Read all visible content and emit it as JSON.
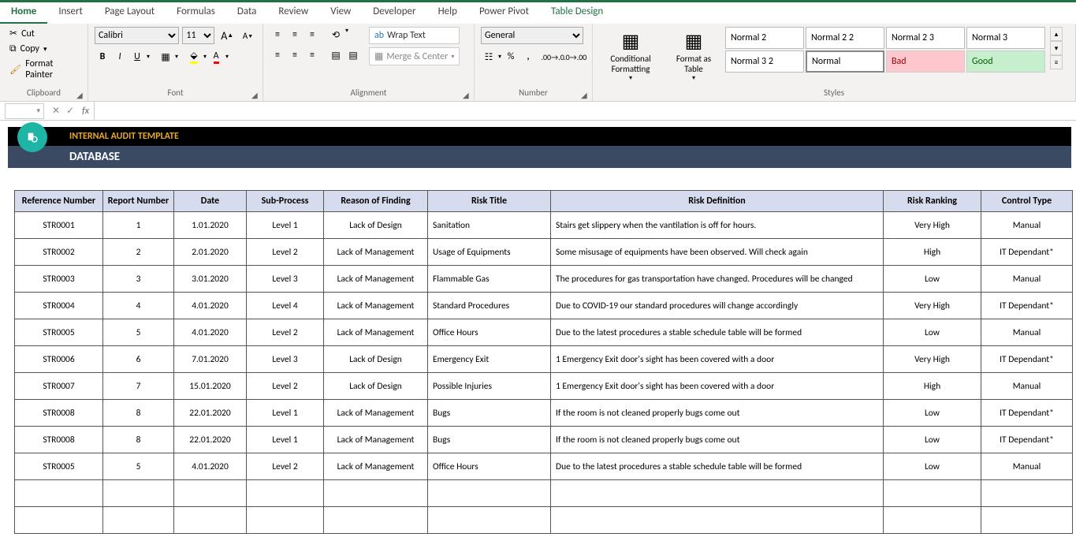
{
  "tabs": [
    "Home",
    "Insert",
    "Page Layout",
    "Formulas",
    "Data",
    "Review",
    "View",
    "Developer",
    "Help",
    "Power Pivot",
    "Table Design"
  ],
  "clipboard": {
    "cut": "Cut",
    "copy": "Copy",
    "painter": "Format Painter",
    "label": "Clipboard"
  },
  "font": {
    "name": "Calibri",
    "size": "11",
    "label": "Font"
  },
  "alignment": {
    "wrap": "Wrap Text",
    "merge": "Merge & Center",
    "label": "Alignment"
  },
  "number": {
    "format": "General",
    "label": "Number"
  },
  "styles": {
    "cond": "Conditional Formatting",
    "fmtas": "Format as Table",
    "cells": [
      "Normal 2",
      "Normal 2 2",
      "Normal 2 3",
      "Normal 3",
      "Normal 3 2",
      "Normal",
      "Bad",
      "Good"
    ],
    "label": "Styles"
  },
  "template_title": "INTERNAL AUDIT TEMPLATE",
  "template_sub": "DATABASE",
  "headers": [
    "Reference Number",
    "Report Number",
    "Date",
    "Sub-Process",
    "Reason of Finding",
    "Risk Title",
    "Risk Definition",
    "Risk Ranking",
    "Control Type"
  ],
  "rows": [
    {
      "ref": "STR0001",
      "rep": "1",
      "date": "1.01.2020",
      "sub": "Level 1",
      "reason": "Lack of Design",
      "title": "Sanitation",
      "def": "Stairs get slippery when the vantilation is off for hours.",
      "rank": "Very High",
      "ctrl": "Manual"
    },
    {
      "ref": "STR0002",
      "rep": "2",
      "date": "2.01.2020",
      "sub": "Level 2",
      "reason": "Lack of Management",
      "title": "Usage of Equipments",
      "def": "Some misusage of equipments have been observed. Will check again",
      "rank": "High",
      "ctrl": "IT Dependant*"
    },
    {
      "ref": "STR0003",
      "rep": "3",
      "date": "3.01.2020",
      "sub": "Level 3",
      "reason": "Lack of Management",
      "title": "Flammable Gas",
      "def": "The procedures for gas transportation have changed. Procedures will be changed",
      "rank": "Low",
      "ctrl": "Manual"
    },
    {
      "ref": "STR0004",
      "rep": "4",
      "date": "4.01.2020",
      "sub": "Level 4",
      "reason": "Lack of Management",
      "title": "Standard Procedures",
      "def": "Due to COVID-19 our standard procedures will change accordingly",
      "rank": "Very High",
      "ctrl": "IT Dependant*"
    },
    {
      "ref": "STR0005",
      "rep": "5",
      "date": "4.01.2020",
      "sub": "Level 2",
      "reason": "Lack of Management",
      "title": "Office Hours",
      "def": "Due to the latest procedures a stable schedule table will be formed",
      "rank": "Low",
      "ctrl": "Manual"
    },
    {
      "ref": "STR0006",
      "rep": "6",
      "date": "7.01.2020",
      "sub": "Level 3",
      "reason": "Lack of Design",
      "title": "Emergency Exit",
      "def": "1 Emergency Exit door's sight has been covered with a door",
      "rank": "Very High",
      "ctrl": "IT Dependant*"
    },
    {
      "ref": "STR0007",
      "rep": "7",
      "date": "15.01.2020",
      "sub": "Level 2",
      "reason": "Lack of Design",
      "title": "Possible Injuries",
      "def": "1 Emergency Exit door's sight has been covered with a door",
      "rank": "High",
      "ctrl": "Manual"
    },
    {
      "ref": "STR0008",
      "rep": "8",
      "date": "22.01.2020",
      "sub": "Level 1",
      "reason": "Lack of Management",
      "title": "Bugs",
      "def": "If the room is not cleaned properly bugs come out",
      "rank": "Low",
      "ctrl": "IT Dependant*"
    },
    {
      "ref": "STR0008",
      "rep": "8",
      "date": "22.01.2020",
      "sub": "Level 1",
      "reason": "Lack of Management",
      "title": "Bugs",
      "def": "If the room is not cleaned properly bugs come out",
      "rank": "Low",
      "ctrl": "IT Dependant*"
    },
    {
      "ref": "STR0005",
      "rep": "5",
      "date": "4.01.2020",
      "sub": "Level 2",
      "reason": "Lack of Management",
      "title": "Office Hours",
      "def": "Due to the latest procedures a stable schedule table will be formed",
      "rank": "Low",
      "ctrl": "Manual"
    },
    {
      "ref": "",
      "rep": "",
      "date": "",
      "sub": "",
      "reason": "",
      "title": "",
      "def": "",
      "rank": "",
      "ctrl": ""
    },
    {
      "ref": "",
      "rep": "",
      "date": "",
      "sub": "",
      "reason": "",
      "title": "",
      "def": "",
      "rank": "",
      "ctrl": ""
    }
  ]
}
